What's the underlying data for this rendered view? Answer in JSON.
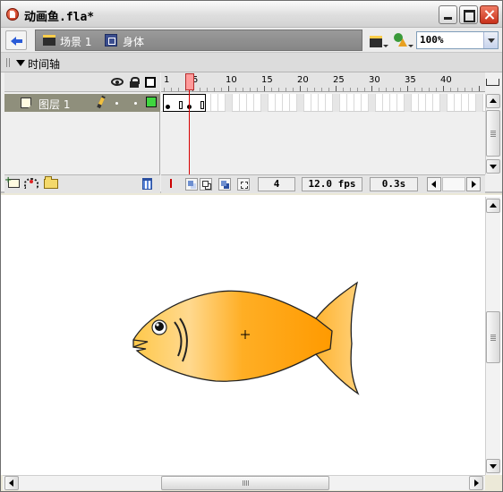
{
  "window": {
    "title": "动画鱼.fla*"
  },
  "editbar": {
    "scene_label": "场景 1",
    "symbol_label": "身体",
    "zoom_value": "100%"
  },
  "timeline": {
    "label": "时间轴",
    "layer": {
      "name": "图层 1",
      "color": "#3fd63f"
    },
    "ruler_labels": [
      "1",
      "5",
      "10",
      "15",
      "20",
      "25",
      "30",
      "35",
      "40"
    ],
    "current_frame": "4",
    "frame_rate": "12.0 fps",
    "elapsed_time": "0.3s"
  },
  "colors": {
    "playhead": "#d80000",
    "fish_body_light": "#ffd584",
    "fish_body_dark": "#ff9a00"
  },
  "icons": [
    "back-arrow-icon",
    "scene-icon",
    "symbol-icon",
    "edit-scene-icon",
    "edit-symbols-icon",
    "eye-icon",
    "lock-icon",
    "outline-icon",
    "layer-icon",
    "pencil-icon",
    "add-layer-icon",
    "add-motion-guide-icon",
    "add-layer-folder-icon",
    "trash-icon",
    "center-frame-icon",
    "onion-skin-icon",
    "timeline-menu-icon"
  ]
}
